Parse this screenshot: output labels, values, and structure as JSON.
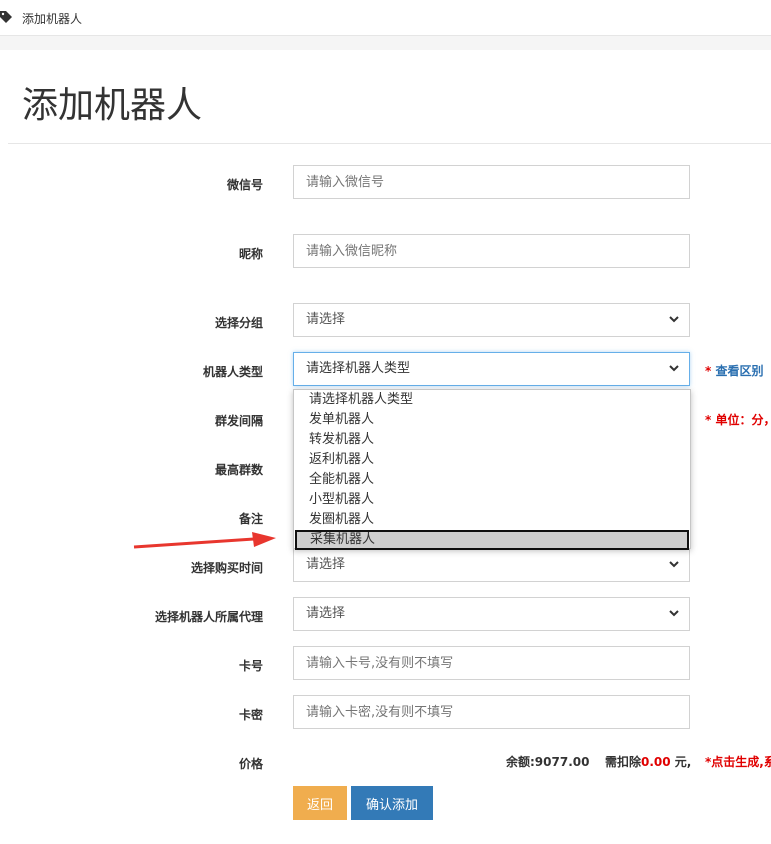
{
  "breadcrumb": {
    "text": "添加机器人",
    "icon": "tag-icon"
  },
  "page_title": "添加机器人",
  "fields": {
    "wechat": {
      "label": "微信号",
      "placeholder": "请输入微信号"
    },
    "nickname": {
      "label": "昵称",
      "placeholder": "请输入微信昵称"
    },
    "group": {
      "label": "选择分组",
      "value": "请选择"
    },
    "robot_type": {
      "label": "机器人类型",
      "value": "请选择机器人类型",
      "hint_star": "*",
      "hint_text": "查看区别",
      "options": [
        "请选择机器人类型",
        "发单机器人",
        "转发机器人",
        "返利机器人",
        "全能机器人",
        "小型机器人",
        "发圈机器人",
        "采集机器人"
      ],
      "highlighted_option": "采集机器人"
    },
    "interval": {
      "label": "群发间隔",
      "hint": "* 单位：分，"
    },
    "max_groups": {
      "label": "最高群数"
    },
    "remark": {
      "label": "备注"
    },
    "buy_time": {
      "label": "选择购买时间",
      "value": "请选择"
    },
    "agent": {
      "label": "选择机器人所属代理",
      "value": "请选择"
    },
    "card_no": {
      "label": "卡号",
      "placeholder": "请输入卡号,没有则不填写"
    },
    "card_pwd": {
      "label": "卡密",
      "placeholder": "请输入卡密,没有则不填写"
    },
    "price": {
      "label": "价格",
      "balance": "余额:9077.00",
      "deduct_prefix": "需扣除",
      "deduct_amount": "0.00",
      "deduct_suffix": " 元,",
      "note": "*点击生成,系"
    }
  },
  "buttons": {
    "back": "返回",
    "confirm": "确认添加"
  },
  "colors": {
    "accent_blue": "#337ab7",
    "warn_orange": "#f0ad4e",
    "red": "#e00000",
    "arrow": "#e8362e"
  }
}
